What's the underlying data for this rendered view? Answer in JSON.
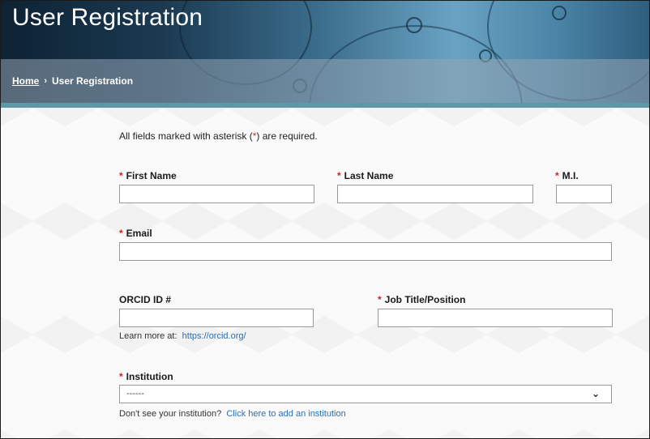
{
  "header": {
    "title": "User Registration",
    "breadcrumb": {
      "home": "Home",
      "separator": "›",
      "current": "User Registration"
    }
  },
  "form": {
    "required_note_before": "All fields marked with asterisk (",
    "required_note_asterisk": "*",
    "required_note_after": ") are required.",
    "required_marker": "*",
    "fields": {
      "first_name": {
        "label": "First Name",
        "value": ""
      },
      "last_name": {
        "label": "Last Name",
        "value": ""
      },
      "middle_initial": {
        "label": "M.I.",
        "value": ""
      },
      "email": {
        "label": "Email",
        "value": ""
      },
      "orcid": {
        "label": "ORCID ID #",
        "value": ""
      },
      "job_title": {
        "label": "Job Title/Position",
        "value": ""
      },
      "institution": {
        "label": "Institution",
        "selected": "------"
      }
    },
    "orcid_help": {
      "text": "Learn more at:",
      "link": "https://orcid.org/"
    },
    "institution_help": {
      "text": "Don't see your institution?",
      "link": "Click here to add an institution"
    }
  },
  "icons": {
    "chevron": "chevron-down-icon"
  },
  "colors": {
    "required": "#d42020",
    "link": "#2a6fb0",
    "accent_strip": "#5b9aa4"
  }
}
